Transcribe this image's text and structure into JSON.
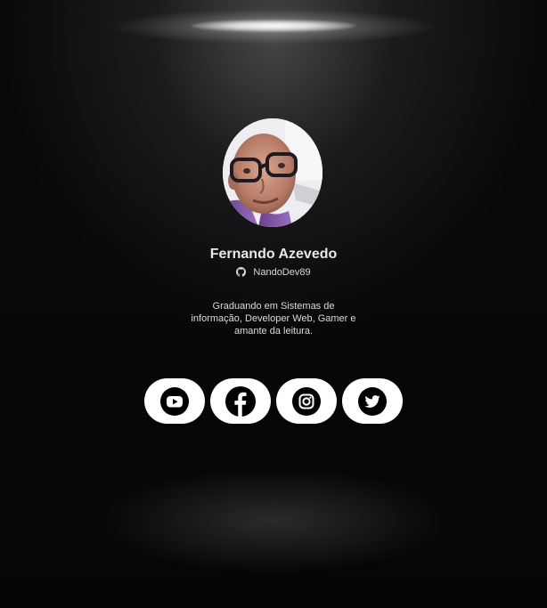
{
  "profile": {
    "name": "Fernando Azevedo",
    "github_handle": "NandoDev89",
    "bio": "Graduando em Sistemas de informação, Developer Web, Gamer e amante da leitura."
  },
  "icons": {
    "avatar": "profile-photo",
    "github": "github-icon",
    "social": [
      "youtube-icon",
      "facebook-icon",
      "instagram-icon",
      "twitter-icon"
    ]
  },
  "colors": {
    "background": "#000000",
    "button_bg": "#ffffff",
    "icon": "#000000",
    "text": "#e6e6e6"
  }
}
